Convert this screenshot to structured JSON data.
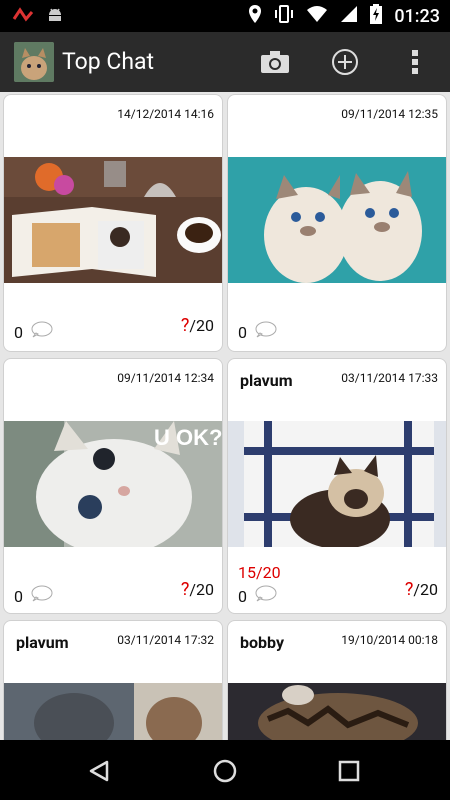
{
  "status_bar": {
    "time": "01:23",
    "icons": [
      "game-notification-icon",
      "android-icon",
      "location-icon",
      "vibrate-icon",
      "wifi-icon",
      "signal-icon",
      "battery-charging-icon"
    ]
  },
  "app_bar": {
    "title": "Top Chat",
    "actions": [
      "camera-icon",
      "add-circle-icon",
      "overflow-menu-icon"
    ]
  },
  "posts": [
    {
      "user": "",
      "date": "14/12/2014 14:16",
      "image": "cat-photo-book-coffee",
      "score": "",
      "comments": "0",
      "rating_mark": "?",
      "rating_max": "/20"
    },
    {
      "user": "",
      "date": "09/11/2014 12:35",
      "image": "two-white-kittens",
      "score": "",
      "comments": "0",
      "rating_mark": "",
      "rating_max": ""
    },
    {
      "user": "",
      "date": "09/11/2014 12:34",
      "image": "kitten-u-ok-meme",
      "score": "",
      "comments": "0",
      "rating_mark": "?",
      "rating_max": "/20"
    },
    {
      "user": "plavum",
      "date": "03/11/2014 17:33",
      "image": "siamese-cat-chair",
      "score": "15/20",
      "comments": "0",
      "rating_mark": "?",
      "rating_max": "/20"
    },
    {
      "user": "plavum",
      "date": "03/11/2014 17:32",
      "image": "cat-indoor-window",
      "score": "",
      "comments": "",
      "rating_mark": "",
      "rating_max": ""
    },
    {
      "user": "bobby",
      "date": "19/10/2014 00:18",
      "image": "tabby-cat-blanket",
      "score": "",
      "comments": "",
      "rating_mark": "",
      "rating_max": ""
    }
  ],
  "nav_bar": [
    "back-icon",
    "home-icon",
    "recents-icon"
  ]
}
